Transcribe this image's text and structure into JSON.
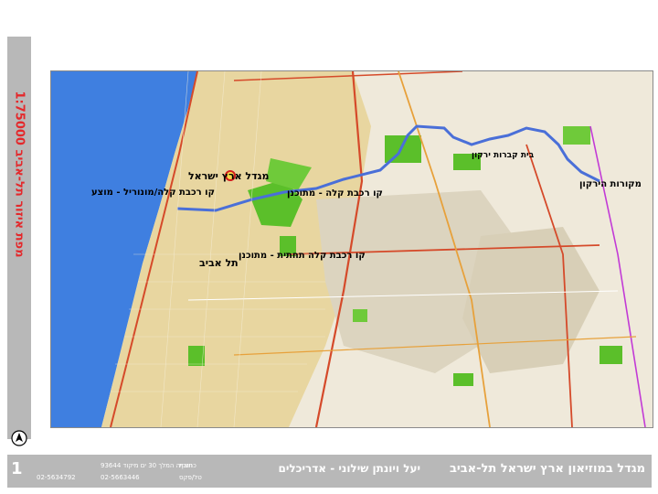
{
  "sidebar": {
    "title": "מפת איזור תל-אביב 1:75000"
  },
  "map": {
    "labels": {
      "museum": "מגדל ארץ ישראל",
      "monorail_line": "קו רכבת קלה/מונוריל - מוצע",
      "tel_aviv": "תל אביב",
      "light_rail": "קו רכבת קלה - מתוכנן",
      "underground": "קו רכבת קלה תחתית - מתוכנן",
      "cemetery": "בית קברות ירקון",
      "yarkon_springs": "מקורות הירקון"
    },
    "colors": {
      "sea": "#3f7fe0",
      "urban": "#e9d9a7",
      "park": "#5bbf2a",
      "route": "#4a6fd8",
      "road": "#d54a2a"
    }
  },
  "footer": {
    "page_number": "1",
    "title": "מגדל במוזיאון ארץ ישראל תל-אביב",
    "architects": "יעל ויונתן שילוני - אדריכלים",
    "address_label": "כתובת",
    "phone_label": "טל/פקס",
    "address": "חזקיה המלך 30 ים מיקוד 93644",
    "phone1": "02-5634792",
    "phone2": "02-5663446"
  }
}
